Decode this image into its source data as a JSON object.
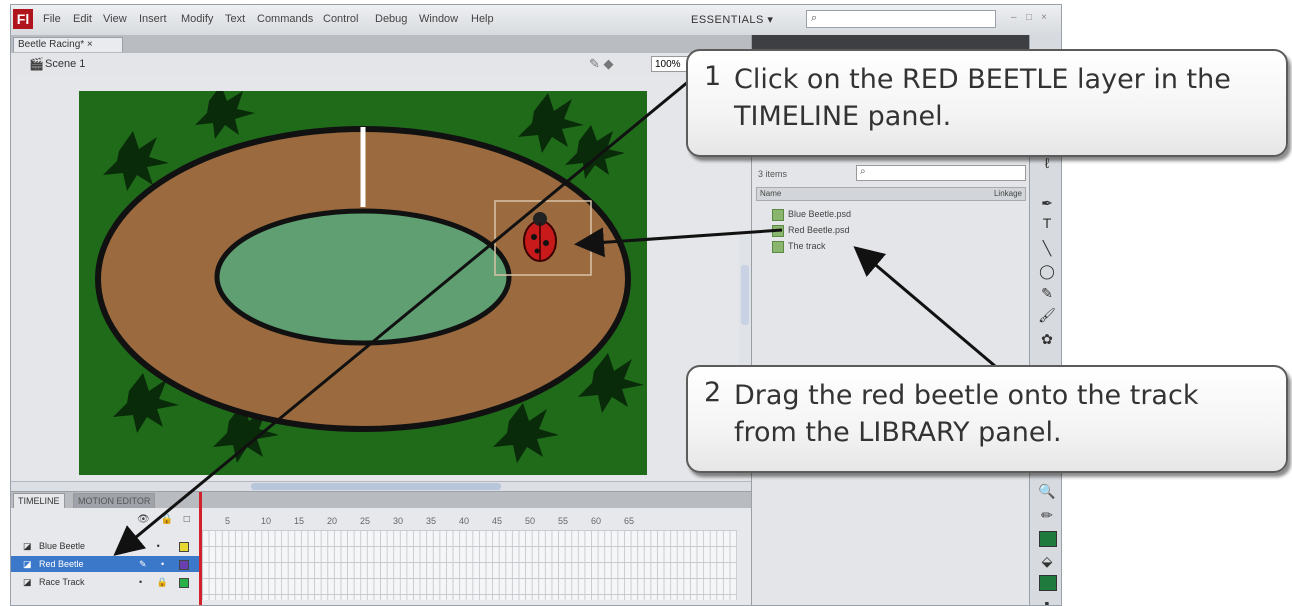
{
  "menubar": {
    "logo": "Fl",
    "items": [
      "File",
      "Edit",
      "View",
      "Insert",
      "Modify",
      "Text",
      "Commands",
      "Control",
      "Debug",
      "Window",
      "Help"
    ],
    "workspace_label": "ESSENTIALS ▾",
    "search_placeholder": ""
  },
  "document": {
    "tab_label": "Beetle Racing* ×",
    "scene_label": "Scene 1",
    "zoom": "100%"
  },
  "timeline": {
    "tabs": [
      "TIMELINE",
      "MOTION EDITOR"
    ],
    "frame_numbers": [
      "5",
      "10",
      "15",
      "20",
      "25",
      "30",
      "35",
      "40",
      "45",
      "50",
      "55",
      "60",
      "65"
    ],
    "layers": [
      {
        "name": "Blue Beetle",
        "selected": false,
        "color": "#e8d830"
      },
      {
        "name": "Red Beetle",
        "selected": true,
        "color": "#6a3fb0"
      },
      {
        "name": "Race Track",
        "selected": false,
        "color": "#2bb04a"
      }
    ]
  },
  "library": {
    "count": "3 items",
    "col_name": "Name",
    "col_linkage": "Linkage",
    "items": [
      "Blue Beetle.psd",
      "Red Beetle.psd",
      "The track"
    ]
  },
  "callouts": {
    "step1_num": "1",
    "step1_text": "Click on the RED BEETLE layer in the TIMELINE panel.",
    "step2_num": "2",
    "step2_text": "Drag the red beetle onto the track from the LIBRARY panel."
  },
  "colors": {
    "stage_green": "#1f6b1a",
    "track_brown": "#9b6a3f",
    "infield_green": "#5f9f72",
    "selection_blue": "#3c78c9"
  }
}
